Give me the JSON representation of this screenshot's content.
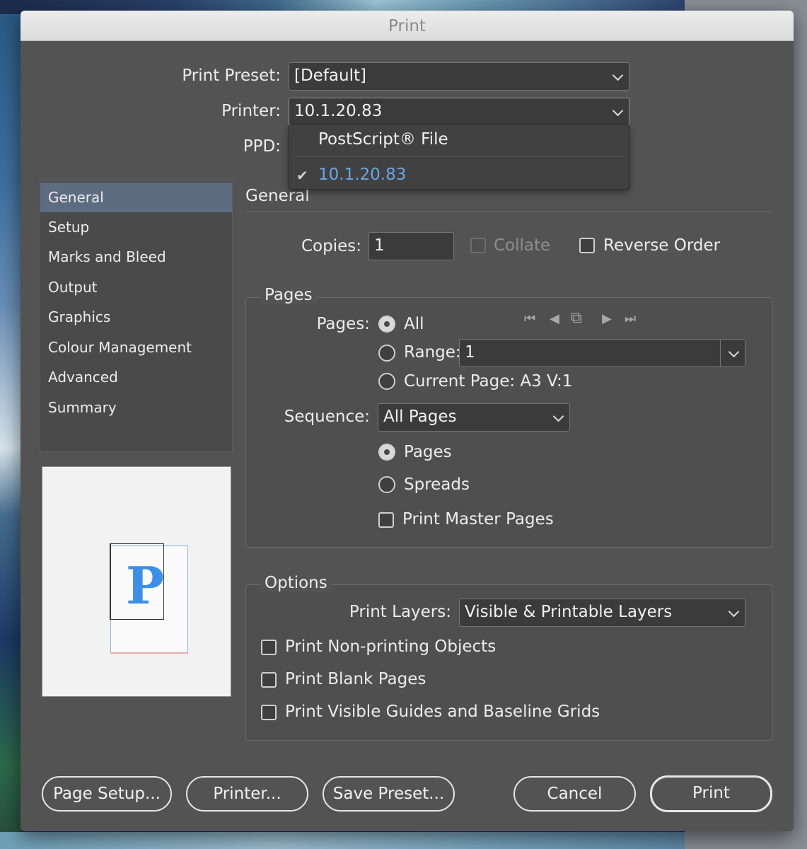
{
  "window": {
    "title": "Print"
  },
  "preset": {
    "label": "Print Preset:",
    "value": "[Default]"
  },
  "printer": {
    "label": "Printer:",
    "value": "10.1.20.83",
    "menu": [
      {
        "label": "PostScript® File",
        "checked": false
      },
      {
        "label": "10.1.20.83",
        "checked": true
      }
    ]
  },
  "ppd": {
    "label": "PPD:"
  },
  "sidebar": {
    "items": [
      {
        "label": "General",
        "selected": true
      },
      {
        "label": "Setup"
      },
      {
        "label": "Marks and Bleed"
      },
      {
        "label": "Output"
      },
      {
        "label": "Graphics"
      },
      {
        "label": "Colour Management"
      },
      {
        "label": "Advanced"
      },
      {
        "label": "Summary"
      }
    ]
  },
  "preview": {
    "glyph": "P",
    "accent": "#3b8fe8"
  },
  "general": {
    "heading": "General",
    "copies_label": "Copies:",
    "copies_value": "1",
    "collate_label": "Collate",
    "collate_checked": false,
    "collate_enabled": false,
    "reverse_label": "Reverse Order",
    "reverse_checked": false
  },
  "pages": {
    "title": "Pages",
    "label": "Pages:",
    "all_label": "All",
    "range_label": "Range:",
    "range_value": "1",
    "current_label": "Current Page: A3 V:1",
    "selected": "All",
    "sequence_label": "Sequence:",
    "sequence_value": "All Pages",
    "pages_option": "Pages",
    "spreads_option": "Spreads",
    "layout_selected": "Pages",
    "master_label": "Print Master Pages",
    "master_checked": false,
    "nav_icons": [
      "first-page-icon",
      "previous-page-icon",
      "spread-icon",
      "next-page-icon",
      "last-page-icon"
    ]
  },
  "options": {
    "title": "Options",
    "layers_label": "Print Layers:",
    "layers_value": "Visible & Printable Layers",
    "nonprinting_label": "Print Non-printing Objects",
    "blank_label": "Print Blank Pages",
    "guides_label": "Print Visible Guides and Baseline Grids"
  },
  "buttons": {
    "page_setup": "Page Setup...",
    "printer": "Printer...",
    "save_preset": "Save Preset...",
    "cancel": "Cancel",
    "print": "Print"
  }
}
